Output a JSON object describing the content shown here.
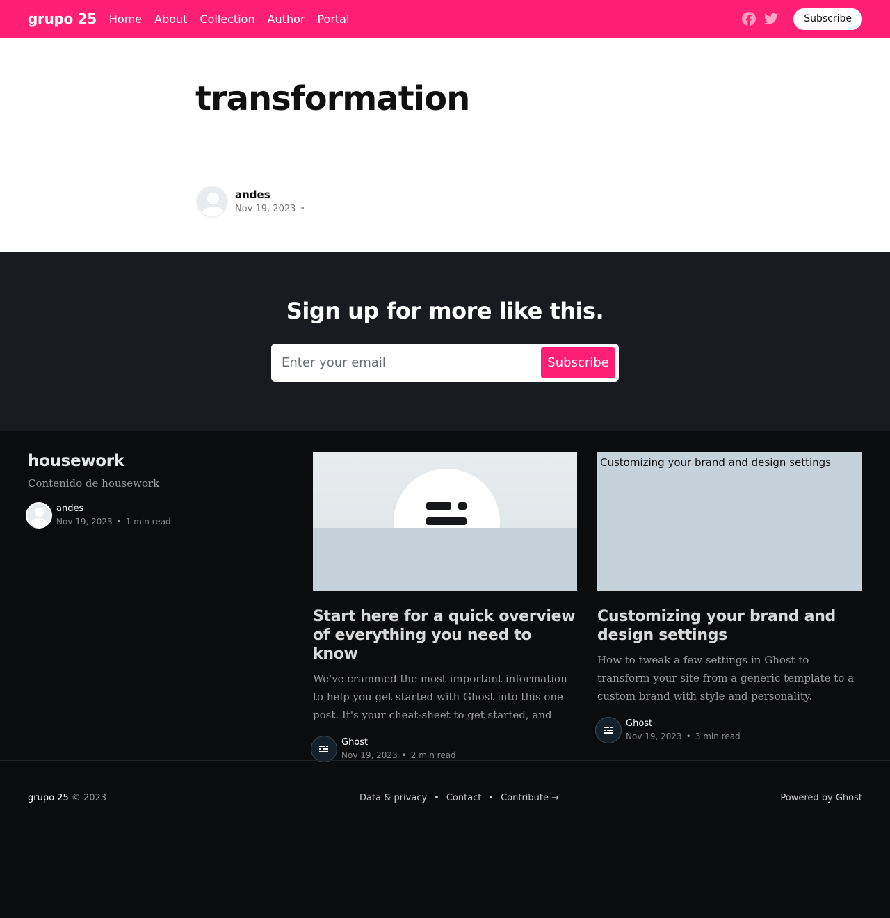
{
  "header": {
    "brand": "grupo 25",
    "nav": [
      "Home",
      "About",
      "Collection",
      "Author",
      "Portal"
    ],
    "subscribe_label": "Subscribe"
  },
  "article": {
    "title": "transformation",
    "author": "andes",
    "date": "Nov 19, 2023"
  },
  "signup": {
    "heading": "Sign up for more like this.",
    "email_placeholder": "Enter your email",
    "button_label": "Subscribe"
  },
  "feed": {
    "intro": {
      "title": "housework",
      "description": "Contenido de housework",
      "author": "andes",
      "date": "Nov 19, 2023",
      "read_time": "1 min read"
    },
    "cards": [
      {
        "title": "Start here for a quick overview of everything you need to know",
        "excerpt": "We've crammed the most important information to help you get started with Ghost into this one post. It's your cheat-sheet to get started, and your shortcut to...",
        "author": "Ghost",
        "date": "Nov 19, 2023",
        "read_time": "2 min read"
      },
      {
        "image_alt": "Customizing your brand and design settings",
        "title": "Customizing your brand and design settings",
        "excerpt": "How to tweak a few settings in Ghost to transform your site from a generic template to a custom brand with style and personality.",
        "author": "Ghost",
        "date": "Nov 19, 2023",
        "read_time": "3 min read"
      }
    ]
  },
  "footer": {
    "brand": "grupo 25",
    "copyright": "© 2023",
    "links": [
      "Data & privacy",
      "Contact",
      "Contribute →"
    ],
    "powered": "Powered by Ghost"
  },
  "colors": {
    "accent": "#ff1f74",
    "signup_bg": "#1a1b20",
    "feed_bg": "#0b0c0e"
  }
}
